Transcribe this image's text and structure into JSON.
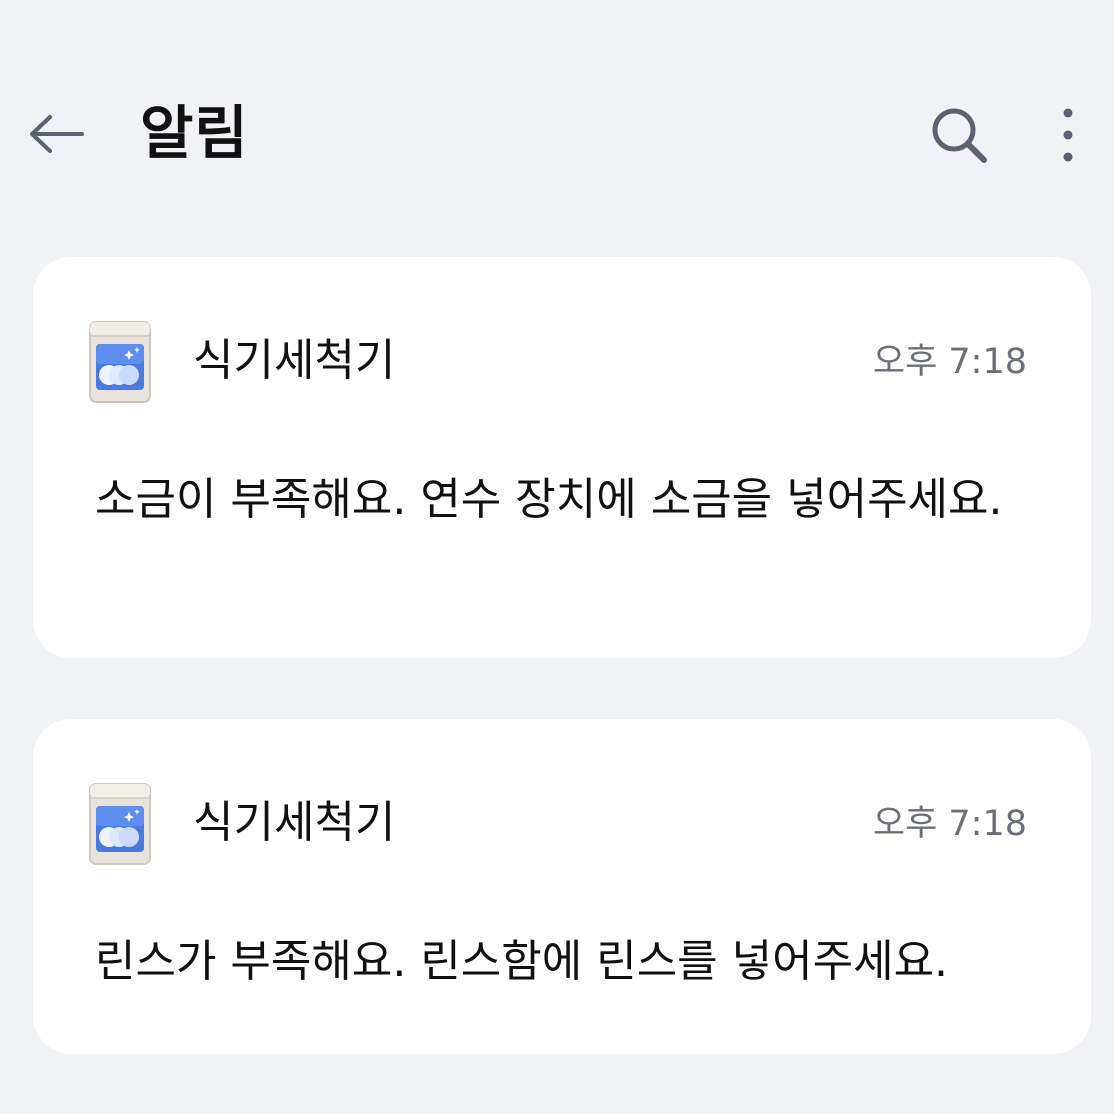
{
  "header": {
    "title": "알림",
    "back_icon": "arrow-left-icon",
    "search_icon": "search-icon",
    "more_icon": "more-vertical-icon"
  },
  "notifications": [
    {
      "app_icon": "dishwasher-icon",
      "app_name": "식기세척기",
      "time": "오후 7:18",
      "message": "소금이 부족해요. 연수 장치에 소금을 넣어주세요."
    },
    {
      "app_icon": "dishwasher-icon",
      "app_name": "식기세척기",
      "time": "오후 7:18",
      "message": "린스가 부족해요. 린스함에 린스를 넣어주세요."
    }
  ],
  "colors": {
    "background": "#f1f2f6",
    "card": "#ffffff",
    "time_text": "#6b6f78",
    "icon": "#5c6170"
  }
}
